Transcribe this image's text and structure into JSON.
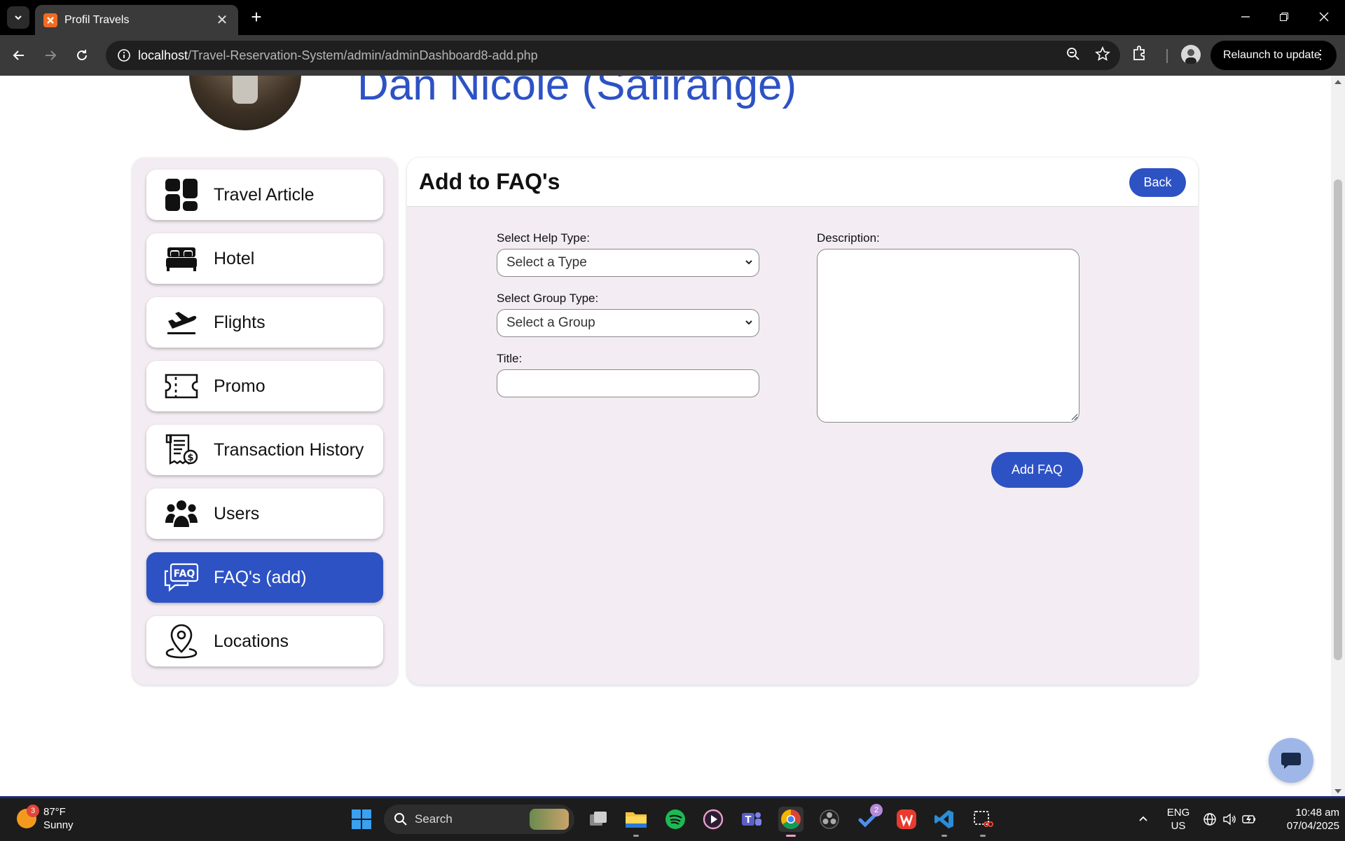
{
  "browser": {
    "tab_title": "Profil Travels",
    "tab_close": "✕",
    "new_tab": "+",
    "url_host": "localhost",
    "url_path": "/Travel-Reservation-System/admin/adminDashboard8-add.php",
    "relaunch_label": "Relaunch to update"
  },
  "header": {
    "admin_name": "Dan Nicole (Safirange)"
  },
  "sidebar": {
    "items": [
      {
        "label": "Travel Article",
        "icon": "dashboard-icon"
      },
      {
        "label": "Hotel",
        "icon": "bed-icon"
      },
      {
        "label": "Flights",
        "icon": "plane-departure-icon"
      },
      {
        "label": "Promo",
        "icon": "ticket-icon"
      },
      {
        "label": "Transaction History",
        "icon": "receipt-icon"
      },
      {
        "label": "Users",
        "icon": "users-icon"
      },
      {
        "label": "FAQ's (add)",
        "icon": "faq-icon",
        "active": true
      },
      {
        "label": "Locations",
        "icon": "map-pin-icon"
      }
    ]
  },
  "panel": {
    "title": "Add to FAQ's",
    "back_label": "Back",
    "help_type_label": "Select Help Type:",
    "help_type_value": "Select a Type",
    "group_type_label": "Select Group Type:",
    "group_type_value": "Select a Group",
    "title_label": "Title:",
    "title_value": "",
    "description_label": "Description:",
    "description_value": "",
    "add_label": "Add FAQ"
  },
  "taskbar": {
    "weather_temp": "87°F",
    "weather_desc": "Sunny",
    "weather_badge": "3",
    "search_label": "Search",
    "todo_badge": "2",
    "lang_top": "ENG",
    "lang_bottom": "US",
    "time": "10:48 am",
    "date": "07/04/2025"
  },
  "colors": {
    "accent": "#2d52c4",
    "panel_bg": "#f3ecf2"
  }
}
